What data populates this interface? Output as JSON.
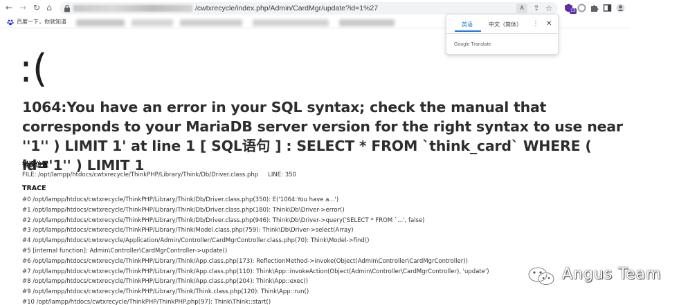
{
  "browser": {
    "nav": {
      "back_icon": "back-arrow-icon",
      "forward_icon": "forward-arrow-icon",
      "reload_icon": "reload-icon",
      "home_icon": "home-icon"
    },
    "url_visible": "/cwtxrecycle/index.php/Admin/CardMgr/update?id=1%27",
    "translate_badge": "A",
    "extension_badge": "13",
    "bookmark_label": "百度一下，你就知道"
  },
  "translate_popup": {
    "tab_source": "英语",
    "tab_target": "中文（简体）",
    "more_symbol": "⋮",
    "close_symbol": "✕",
    "footer_brand": "Google",
    "footer_product": "Translate"
  },
  "error_page": {
    "face": ":(",
    "title": "1064:You have an error in your SQL syntax; check the manual that corresponds to your MariaDB server version for the right syntax to use near ''1'' ) LIMIT 1' at line 1 [ SQL语句 ] : SELECT * FROM `think_card` WHERE ( id='1'' ) LIMIT 1",
    "location_heading": "错误位置",
    "file_label": "FILE: /opt/lampp/htdocs/cwtxrecycle/ThinkPHP/Library/Think/Db/Driver.class.php",
    "line_label": "LINE: 350",
    "trace_heading": "TRACE",
    "trace": [
      "#0 /opt/lampp/htdocs/cwtxrecycle/ThinkPHP/Library/Think/Db/Driver.class.php(350): E('1064:You have a...')",
      "#1 /opt/lampp/htdocs/cwtxrecycle/ThinkPHP/Library/Think/Db/Driver.class.php(180): Think\\Db\\Driver->error()",
      "#2 /opt/lampp/htdocs/cwtxrecycle/ThinkPHP/Library/Think/Db/Driver.class.php(946): Think\\Db\\Driver->query('SELECT * FROM `...', false)",
      "#3 /opt/lampp/htdocs/cwtxrecycle/ThinkPHP/Library/Think/Model.class.php(759): Think\\Db\\Driver->select(Array)",
      "#4 /opt/lampp/htdocs/cwtxrecycle/Application/Admin/Controller/CardMgrController.class.php(70): Think\\Model->find()",
      "#5 [internal function]: Admin\\Controller\\CardMgrController->update()",
      "#6 /opt/lampp/htdocs/cwtxrecycle/ThinkPHP/Library/Think/App.class.php(173): ReflectionMethod->invoke(Object(Admin\\Controller\\CardMgrController))",
      "#7 /opt/lampp/htdocs/cwtxrecycle/ThinkPHP/Library/Think/App.class.php(110): Think\\App::invokeAction(Object(Admin\\Controller\\CardMgrController), 'update')",
      "#8 /opt/lampp/htdocs/cwtxrecycle/ThinkPHP/Library/Think/App.class.php(204): Think\\App::exec()",
      "#9 /opt/lampp/htdocs/cwtxrecycle/ThinkPHP/Library/Think/Think.class.php(120): Think\\App::run()",
      "#10 /opt/lampp/htdocs/cwtxrecycle/ThinkPHP/ThinkPHP.php(97): Think\\Think::start()"
    ]
  },
  "watermark": {
    "text": "Angus Team",
    "logo": "wechat-logo"
  },
  "colors": {
    "accent": "#1a73e8",
    "text": "#2d2d2d",
    "extension_purple": "#5b2ea6"
  }
}
